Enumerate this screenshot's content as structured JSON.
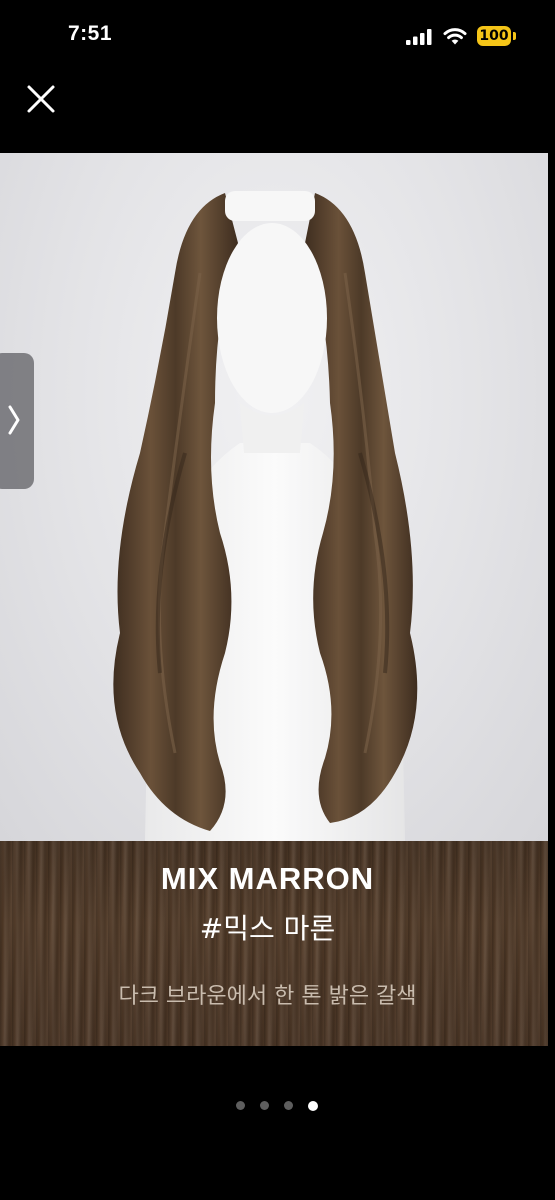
{
  "status_bar": {
    "time": "7:51",
    "battery_level": "100",
    "battery_color": "#f5c518"
  },
  "viewer": {
    "close_icon": "close-icon",
    "next_icon": "chevron-right-icon",
    "pagination": {
      "total": 4,
      "active_index": 3
    }
  },
  "product": {
    "name": "MIX MARRON",
    "tag": "#믹스 마론",
    "description": "다크 브라운에서 한 톤 밝은 갈색",
    "hair_color": "#5a4330"
  }
}
